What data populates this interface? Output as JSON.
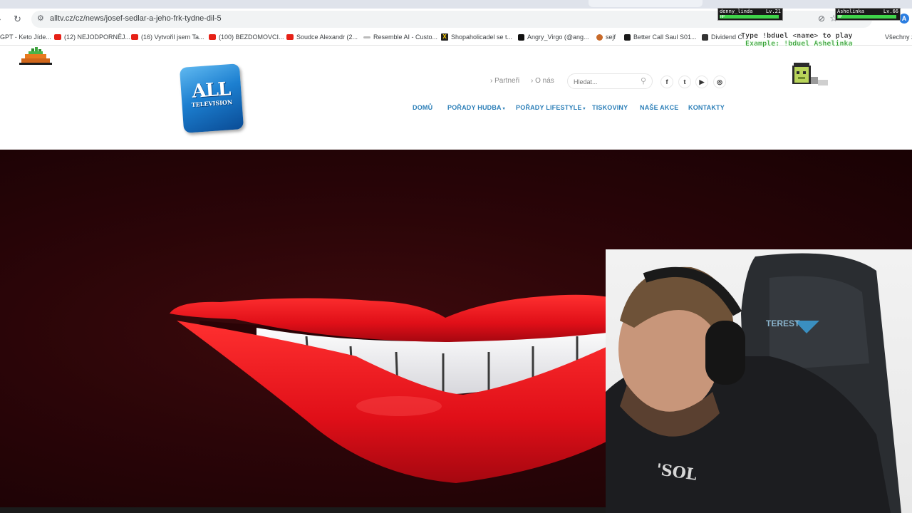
{
  "browser": {
    "address": "alltv.cz/cz/news/josef-sedlar-a-jeho-frk-tydne-dil-5",
    "profile_initial": "A",
    "bookmarks": [
      {
        "label": "GPT - Keto Jíde...",
        "icon": "generic"
      },
      {
        "label": "(12) NEJODPORNĚJ...",
        "icon": "youtube"
      },
      {
        "label": "(16) Vytvořil jsem Ta...",
        "icon": "youtube"
      },
      {
        "label": "(100) BEZDOMOVCI...",
        "icon": "youtube"
      },
      {
        "label": "Soudce Alexandr (2...",
        "icon": "youtube"
      },
      {
        "label": "Resemble AI - Custo...",
        "icon": "resemble"
      },
      {
        "label": "Shopaholicadel se t...",
        "icon": "x"
      },
      {
        "label": "Angry_Virgo (@ang...",
        "icon": "tiktok"
      },
      {
        "label": "sejf",
        "icon": "fox"
      },
      {
        "label": "Better Call Saul S01...",
        "icon": "bcs"
      },
      {
        "label": "Dividend C...",
        "icon": "dividend"
      },
      {
        "label": "Všechny z",
        "icon": "none"
      }
    ]
  },
  "site": {
    "logo_line1": "ALL",
    "logo_line2": "TELEVISION",
    "top_links": [
      "Partneři",
      "O nás"
    ],
    "search_placeholder": "Hledat...",
    "social": [
      "f",
      "t",
      "▶",
      "◎"
    ],
    "nav": [
      "DOMŮ",
      "POŘADY HUDBA",
      "POŘADY LIFESTYLE",
      "TISKOVINY",
      "NAŠE AKCE",
      "KONTAKTY"
    ]
  },
  "overlay": {
    "player1": {
      "name": "denny_linda",
      "level": "Lv.21",
      "hp_label": "HP",
      "hp_fraction": 0.96
    },
    "player2": {
      "name": "Ashelinka",
      "level": "Lv.66",
      "hp_label": "HP",
      "hp_fraction": 0.96
    },
    "command_line": "Type !bduel <name> to play",
    "example_line": "Example: !bduel Ashelinka"
  },
  "colors": {
    "nav_blue": "#2c7fb8",
    "lips_red": "#e0121c",
    "video_bg": "#2b0508",
    "hp_green": "#3fd44a"
  }
}
